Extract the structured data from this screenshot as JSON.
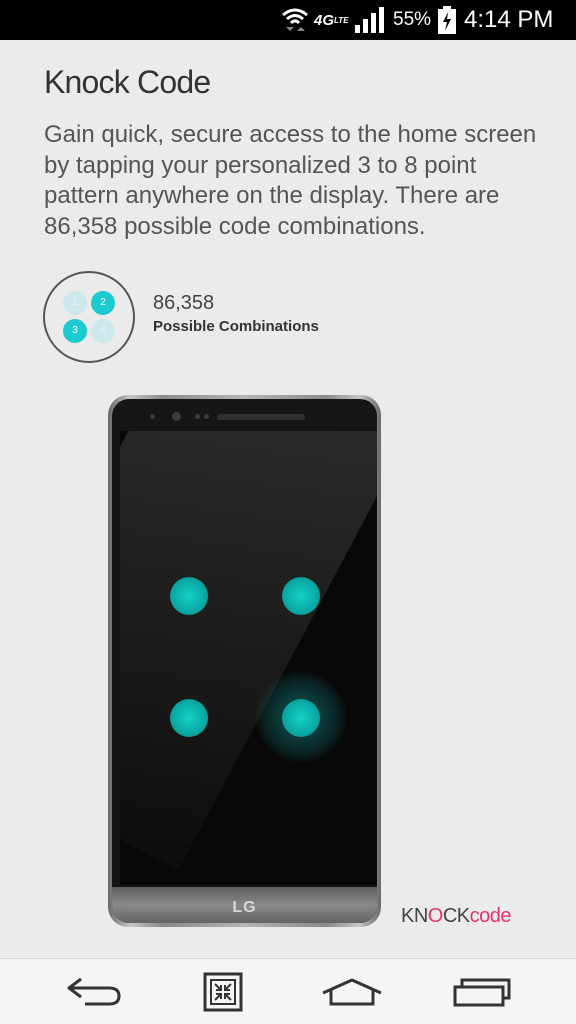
{
  "status_bar": {
    "network": "4G",
    "network_sup": "LTE",
    "battery_percent": "55%",
    "time": "4:14 PM"
  },
  "content": {
    "title": "Knock Code",
    "description": "Gain quick, secure access to the home screen by tapping your personalized 3 to 8 point pattern anywhere on the display. There are 86,358 possible code combinations.",
    "combo_icon_digits": [
      "1",
      "2",
      "3",
      "4"
    ],
    "combo_count": "86,358",
    "combo_label": "Possible Combinations"
  },
  "device": {
    "brand": "LG"
  },
  "logo": {
    "part1": "KN",
    "part2": "O",
    "part3": "CK",
    "part4": "code"
  },
  "colors": {
    "accent_teal": "#15d0c8",
    "logo_pink": "#e4336f"
  },
  "nav_bar": {
    "buttons": [
      "back-icon",
      "dual-window-icon",
      "home-icon",
      "recent-apps-icon"
    ]
  }
}
